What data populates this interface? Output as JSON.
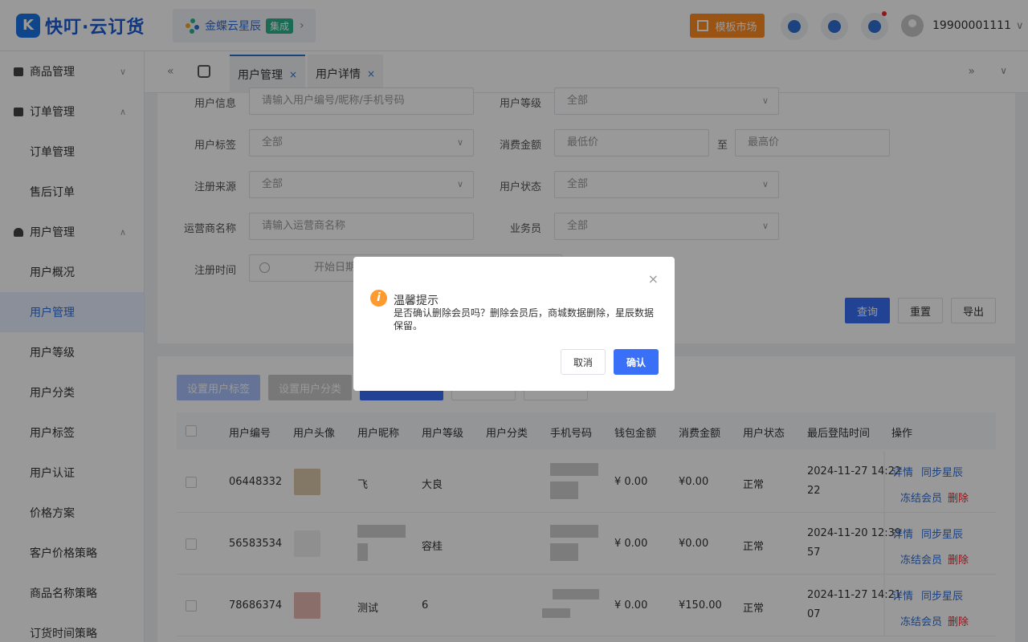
{
  "header": {
    "logo_mark": "K",
    "logo_text": "快叮·云订货",
    "integration_name": "金蝶云星辰",
    "integration_badge": "集成",
    "template_market": "模板市场",
    "user_phone": "19900001111"
  },
  "sidebar": {
    "groups": [
      {
        "label": "商品管理",
        "arrow": "∨"
      },
      {
        "label": "订单管理",
        "arrow": "∧"
      },
      {
        "label": "用户管理",
        "arrow": "∧"
      }
    ],
    "order_items": [
      "订单管理",
      "售后订单"
    ],
    "user_items": [
      "用户概况",
      "用户管理",
      "用户等级",
      "用户分类",
      "用户标签",
      "用户认证",
      "价格方案",
      "客户价格策略",
      "商品名称策略",
      "订货时间策略"
    ]
  },
  "tabs": [
    {
      "label": "用户管理",
      "close": "×"
    },
    {
      "label": "用户详情",
      "close": "×"
    }
  ],
  "filters": {
    "user_info_label": "用户信息",
    "user_info_placeholder": "请输入用户编号/昵称/手机号码",
    "user_level_label": "用户等级",
    "user_level_value": "全部",
    "user_tag_label": "用户标签",
    "user_tag_value": "全部",
    "spend_label": "消费金额",
    "spend_min_placeholder": "最低价",
    "spend_to": "至",
    "spend_max_placeholder": "最高价",
    "reg_source_label": "注册来源",
    "reg_source_value": "全部",
    "user_status_label": "用户状态",
    "user_status_value": "全部",
    "operator_label": "运营商名称",
    "operator_placeholder": "请输入运营商名称",
    "salesman_label": "业务员",
    "salesman_value": "全部",
    "reg_time_label": "注册时间",
    "reg_time_start": "开始日期",
    "query": "查询",
    "reset": "重置",
    "export": "导出"
  },
  "toolbar": {
    "set_tag": "设置用户标签",
    "set_category": "设置用户分类"
  },
  "table": {
    "headers": [
      "用户编号",
      "用户头像",
      "用户昵称",
      "用户等级",
      "用户分类",
      "手机号码",
      "钱包金额",
      "消费金额",
      "用户状态",
      "最后登陆时间",
      "操作"
    ],
    "rows": [
      {
        "id": "06448332",
        "nickname": "飞",
        "level": "大良",
        "wallet": "¥ 0.00",
        "spend": "¥0.00",
        "status": "正常",
        "last_login_1": "2024-11-27 14:22",
        "last_login_2": "22",
        "avatar_color": "#d9c9a8"
      },
      {
        "id": "56583534",
        "nickname": "",
        "level": "容桂",
        "wallet": "¥ 0.00",
        "spend": "¥0.00",
        "status": "正常",
        "last_login_1": "2024-11-20 12:39",
        "last_login_2": "57",
        "avatar_color": "#eeeeee"
      },
      {
        "id": "78686374",
        "nickname": "测试",
        "level": "6",
        "wallet": "¥ 0.00",
        "spend": "¥150.00",
        "status": "正常",
        "last_login_1": "2024-11-27 14:21",
        "last_login_2": "07",
        "avatar_color": "#e6b8b0"
      }
    ],
    "action_detail": "详情",
    "action_sync": "同步星辰",
    "action_freeze": "冻结会员",
    "action_delete": "删除"
  },
  "modal": {
    "icon": "i",
    "title": "温馨提示",
    "message": "是否确认删除会员吗？删除会员后，商城数据删除，星辰数据保留。",
    "cancel": "取消",
    "confirm": "确认",
    "close": "×"
  },
  "colors": {
    "primary": "#3a6ff7",
    "warning": "#ff9a2e",
    "danger": "#f5222d"
  }
}
